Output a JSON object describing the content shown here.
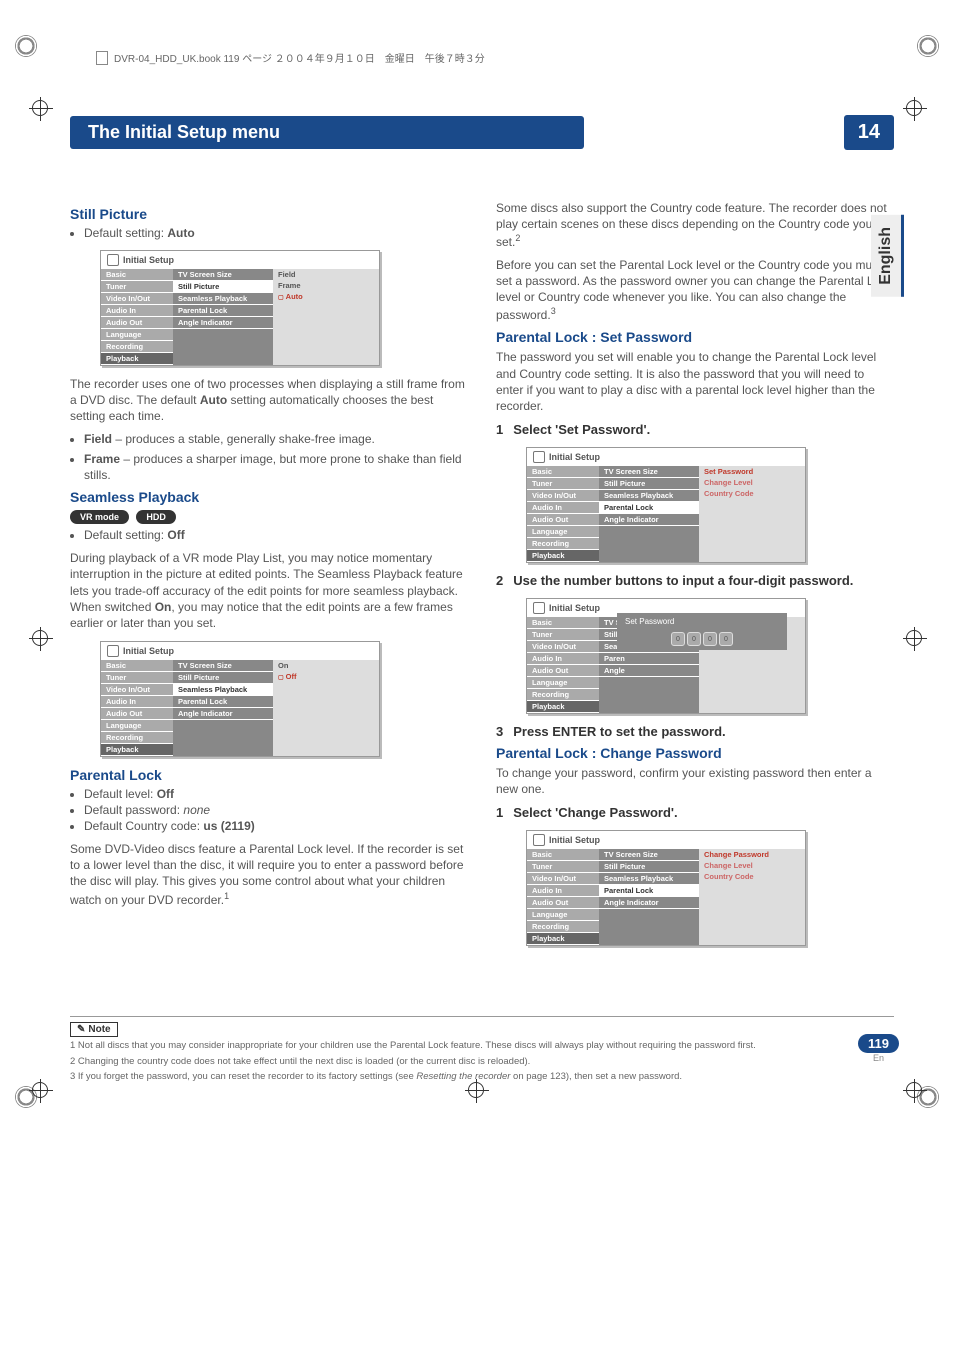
{
  "header": {
    "book_info": "DVR-04_HDD_UK.book  119 ページ  ２００４年９月１０日　金曜日　午後７時３分"
  },
  "title_bar": {
    "title": "The Initial Setup menu",
    "chapter": "14"
  },
  "language_tab": "English",
  "left_col": {
    "still_picture": {
      "heading": "Still Picture",
      "default": "Default setting: ",
      "default_val": "Auto",
      "panel": {
        "title": "Initial Setup",
        "nav": [
          "Basic",
          "Tuner",
          "Video In/Out",
          "Audio In",
          "Audio Out",
          "Language",
          "Recording",
          "Playback"
        ],
        "mid": [
          "TV Screen Size",
          "Still Picture",
          "Seamless Playback",
          "Parental Lock",
          "Angle Indicator"
        ],
        "right": [
          "Field",
          "Frame",
          "Auto"
        ]
      },
      "p1a": "The recorder uses one of two processes when displaying a still frame from a DVD disc. The default ",
      "p1b": "Auto",
      "p1c": " setting automatically chooses the best setting each time.",
      "b1a": "Field",
      "b1b": " – produces a stable, generally shake-free image.",
      "b2a": "Frame",
      "b2b": " – produces a sharper image, but more prone to shake than field stills."
    },
    "seamless": {
      "heading": "Seamless Playback",
      "badges": [
        "VR mode",
        "HDD"
      ],
      "default": "Default setting: ",
      "default_val": "Off",
      "p1a": "During playback of a VR mode Play List, you may notice momentary interruption in the picture at edited points. The Seamless Playback feature lets you trade-off accuracy of the edit points for more seamless playback. When switched ",
      "p1b": "On",
      "p1c": ", you may notice that the edit points are a few frames earlier or later than you set.",
      "panel": {
        "title": "Initial Setup",
        "nav": [
          "Basic",
          "Tuner",
          "Video In/Out",
          "Audio In",
          "Audio Out",
          "Language",
          "Recording",
          "Playback"
        ],
        "mid": [
          "TV Screen Size",
          "Still Picture",
          "Seamless Playback",
          "Parental Lock",
          "Angle Indicator"
        ],
        "right": [
          "On",
          "Off"
        ]
      }
    },
    "parental": {
      "heading": "Parental Lock",
      "b1": "Default level: ",
      "b1v": "Off",
      "b2": "Default password: ",
      "b2v": "none",
      "b3": "Default Country code: ",
      "b3v": "us (2119)",
      "p1": "Some DVD-Video discs feature a Parental Lock level. If the recorder is set to a lower level than the disc, it will require you to enter a password before the disc will play. This gives you some control about what your children watch on your DVD recorder.",
      "sup1": "1"
    }
  },
  "right_col": {
    "intro_p1": "Some discs also support the Country code feature. The recorder does not play certain scenes on these discs depending on the Country code you set.",
    "sup2": "2",
    "intro_p2": "Before you can set the Parental Lock level or the Country code you must set a password. As the password owner you can change the Parental Lock level or Country code whenever you like. You can also change the password.",
    "sup3": "3",
    "set_pw": {
      "heading": "Parental Lock : Set Password",
      "p1": "The password you set will enable you to change the Parental Lock level and Country code setting. It is also the password that you will need to enter if you want to play a disc with a parental lock level higher than the recorder.",
      "step1": "Select 'Set Password'.",
      "panel1": {
        "title": "Initial Setup",
        "nav": [
          "Basic",
          "Tuner",
          "Video In/Out",
          "Audio In",
          "Audio Out",
          "Language",
          "Recording",
          "Playback"
        ],
        "mid": [
          "TV Screen Size",
          "Still Picture",
          "Seamless Playback",
          "Parental Lock",
          "Angle Indicator"
        ],
        "right": [
          "Set Password",
          "Change Level",
          "Country Code"
        ]
      },
      "step2": "Use the number buttons to input a four-digit password.",
      "panel2": {
        "title": "Initial Setup",
        "nav": [
          "Basic",
          "Tuner",
          "Video In/Out",
          "Audio In",
          "Audio Out",
          "Language",
          "Recording",
          "Playback"
        ],
        "mid": [
          "TV Sc",
          "Still P",
          "Seam",
          "Paren",
          "Angle"
        ],
        "popup_title": "Set Password"
      },
      "step3": "Press ENTER to set the password."
    },
    "change_pw": {
      "heading": "Parental Lock : Change Password",
      "p1": "To change your password, confirm your existing password then enter a new one.",
      "step1": "Select 'Change Password'.",
      "panel": {
        "title": "Initial Setup",
        "nav": [
          "Basic",
          "Tuner",
          "Video In/Out",
          "Audio In",
          "Audio Out",
          "Language",
          "Recording",
          "Playback"
        ],
        "mid": [
          "TV Screen Size",
          "Still Picture",
          "Seamless Playback",
          "Parental Lock",
          "Angle Indicator"
        ],
        "right": [
          "Change Password",
          "Change Level",
          "Country Code"
        ]
      }
    }
  },
  "notes": {
    "label": "Note",
    "n1": "1 Not all discs that you may consider inappropriate for your children use the Parental Lock feature. These discs will always play without requiring the password first.",
    "n2": "2 Changing the country code does not take effect until the next disc is loaded (or the current disc is reloaded).",
    "n3a": "3 If you forget the password, you can reset the recorder to its factory settings (see ",
    "n3b": "Resetting the recorder",
    "n3c": " on page 123), then set a new password."
  },
  "page_number": "119",
  "page_lang": "En"
}
